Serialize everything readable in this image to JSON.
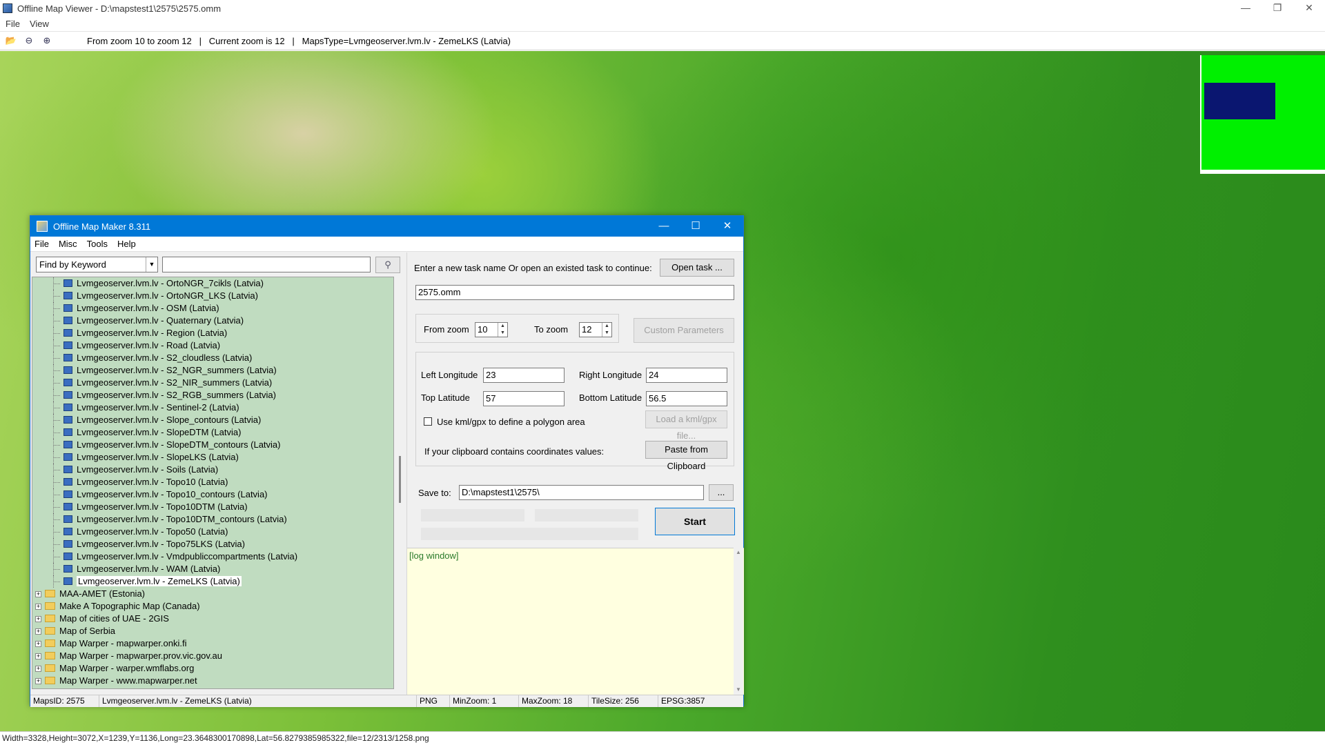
{
  "viewer": {
    "title": "Offline Map Viewer - D:\\mapstest1\\2575\\2575.omm",
    "menu": [
      "File",
      "View"
    ],
    "toolbar_info": "From zoom 10 to zoom 12   |   Current zoom is 12   |   MapsType=Lvmgeoserver.lvm.lv - ZemeLKS (Latvia)",
    "status": "Width=3328,Height=3072,X=1239,Y=1136,Long=23.3648300170898,Lat=56.8279385985322,file=12/2313/1258.png",
    "colors": {
      "minimap_bg": "#00f000",
      "minimap_viewport": "#0a1670"
    }
  },
  "dialog": {
    "title": "Offline Map Maker 8.311",
    "menu": [
      "File",
      "Misc",
      "Tools",
      "Help"
    ],
    "search": {
      "mode": "Find by Keyword",
      "query": ""
    },
    "tree_children": [
      "Lvmgeoserver.lvm.lv - OrtoNGR_7cikls (Latvia)",
      "Lvmgeoserver.lvm.lv - OrtoNGR_LKS (Latvia)",
      "Lvmgeoserver.lvm.lv - OSM (Latvia)",
      "Lvmgeoserver.lvm.lv - Quaternary (Latvia)",
      "Lvmgeoserver.lvm.lv - Region (Latvia)",
      "Lvmgeoserver.lvm.lv - Road (Latvia)",
      "Lvmgeoserver.lvm.lv - S2_cloudless (Latvia)",
      "Lvmgeoserver.lvm.lv - S2_NGR_summers (Latvia)",
      "Lvmgeoserver.lvm.lv - S2_NIR_summers (Latvia)",
      "Lvmgeoserver.lvm.lv - S2_RGB_summers (Latvia)",
      "Lvmgeoserver.lvm.lv - Sentinel-2 (Latvia)",
      "Lvmgeoserver.lvm.lv - Slope_contours (Latvia)",
      "Lvmgeoserver.lvm.lv - SlopeDTM (Latvia)",
      "Lvmgeoserver.lvm.lv - SlopeDTM_contours (Latvia)",
      "Lvmgeoserver.lvm.lv - SlopeLKS (Latvia)",
      "Lvmgeoserver.lvm.lv - Soils (Latvia)",
      "Lvmgeoserver.lvm.lv - Topo10 (Latvia)",
      "Lvmgeoserver.lvm.lv - Topo10_contours (Latvia)",
      "Lvmgeoserver.lvm.lv - Topo10DTM (Latvia)",
      "Lvmgeoserver.lvm.lv - Topo10DTM_contours (Latvia)",
      "Lvmgeoserver.lvm.lv - Topo50 (Latvia)",
      "Lvmgeoserver.lvm.lv - Topo75LKS (Latvia)",
      "Lvmgeoserver.lvm.lv - Vmdpubliccompartments (Latvia)",
      "Lvmgeoserver.lvm.lv - WAM (Latvia)",
      "Lvmgeoserver.lvm.lv - ZemeLKS (Latvia)"
    ],
    "selected_child": "Lvmgeoserver.lvm.lv - ZemeLKS (Latvia)",
    "tree_folders": [
      "MAA-AMET (Estonia)",
      "Make A Topographic Map (Canada)",
      "Map of cities of UAE - 2GIS",
      "Map of Serbia",
      "Map Warper - mapwarper.onki.fi",
      "Map Warper - mapwarper.prov.vic.gov.au",
      "Map Warper - warper.wmflabs.org",
      "Map Warper - www.mapwarper.net"
    ],
    "task": {
      "prompt": "Enter a new task name Or open an existed task to continue:",
      "open_button": "Open task ...",
      "name": "2575.omm"
    },
    "zoom": {
      "from_label": "From zoom",
      "from_value": "10",
      "to_label": "To zoom",
      "to_value": "12",
      "custom_button": "Custom Parameters"
    },
    "bounds": {
      "left_label": "Left Longitude",
      "left_value": "23",
      "right_label": "Right Longitude",
      "right_value": "24",
      "top_label": "Top Latitude",
      "top_value": "57",
      "bottom_label": "Bottom Latitude",
      "bottom_value": "56.5",
      "kml_label": "Use kml/gpx to define a polygon area",
      "kml_button": "Load a kml/gpx file...",
      "clipboard_label": "If your clipboard contains coordinates values:",
      "clipboard_button": "Paste from Clipboard"
    },
    "save": {
      "label": "Save to:",
      "path": "D:\\mapstest1\\2575\\",
      "browse": "..."
    },
    "start_button": "Start",
    "log": "[log window]",
    "status": {
      "maps_id": "MapsID: 2575",
      "map_type": "Lvmgeoserver.lvm.lv - ZemeLKS (Latvia)",
      "format": "PNG",
      "min_zoom": "MinZoom: 1",
      "max_zoom": "MaxZoom: 18",
      "tile_size": "TileSize: 256",
      "epsg": "EPSG:3857"
    }
  }
}
